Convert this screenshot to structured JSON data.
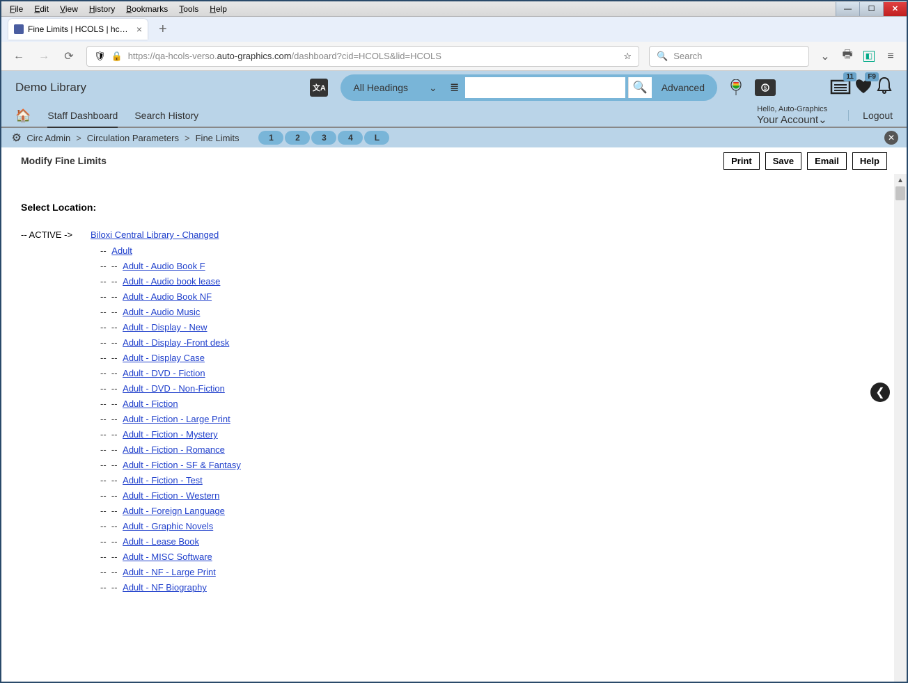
{
  "browser": {
    "menu": [
      "File",
      "Edit",
      "View",
      "History",
      "Bookmarks",
      "Tools",
      "Help"
    ],
    "tab_title": "Fine Limits | HCOLS | hcols | Au",
    "url_prefix": "https://qa-hcols-verso.",
    "url_domain": "auto-graphics.com",
    "url_path": "/dashboard?cid=HCOLS&lid=HCOLS",
    "search_placeholder": "Search"
  },
  "header": {
    "library_name": "Demo Library",
    "headings_label": "All Headings",
    "advanced_label": "Advanced",
    "list_badge": "11",
    "heart_badge": "F9"
  },
  "subheader": {
    "nav1": "Staff Dashboard",
    "nav2": "Search History",
    "hello": "Hello, Auto-Graphics",
    "account": "Your Account",
    "logout": "Logout"
  },
  "crumbs": {
    "c1": "Circ Admin",
    "c2": "Circulation Parameters",
    "c3": "Fine Limits",
    "pills": [
      "1",
      "2",
      "3",
      "4",
      "L"
    ]
  },
  "content": {
    "title": "Modify Fine Limits",
    "buttons": {
      "print": "Print",
      "save": "Save",
      "email": "Email",
      "help": "Help"
    },
    "select_location": "Select Location:",
    "active_prefix": "-- ACTIVE ->",
    "root_library": "Biloxi Central Library - Changed",
    "level1_item": "Adult",
    "level2_items": [
      "Adult - Audio Book F",
      "Adult - Audio book lease",
      "Adult - Audio Book NF",
      "Adult - Audio Music",
      "Adult - Display - New",
      "Adult - Display -Front desk",
      "Adult - Display Case",
      "Adult - DVD - Fiction",
      "Adult - DVD - Non-Fiction",
      "Adult - Fiction",
      "Adult - Fiction - Large Print",
      "Adult - Fiction - Mystery",
      "Adult - Fiction - Romance",
      "Adult - Fiction - SF & Fantasy",
      "Adult - Fiction - Test",
      "Adult - Fiction - Western",
      "Adult - Foreign Language",
      "Adult - Graphic Novels",
      "Adult - Lease Book",
      "Adult - MISC Software",
      "Adult - NF - Large Print",
      "Adult - NF Biography"
    ]
  }
}
